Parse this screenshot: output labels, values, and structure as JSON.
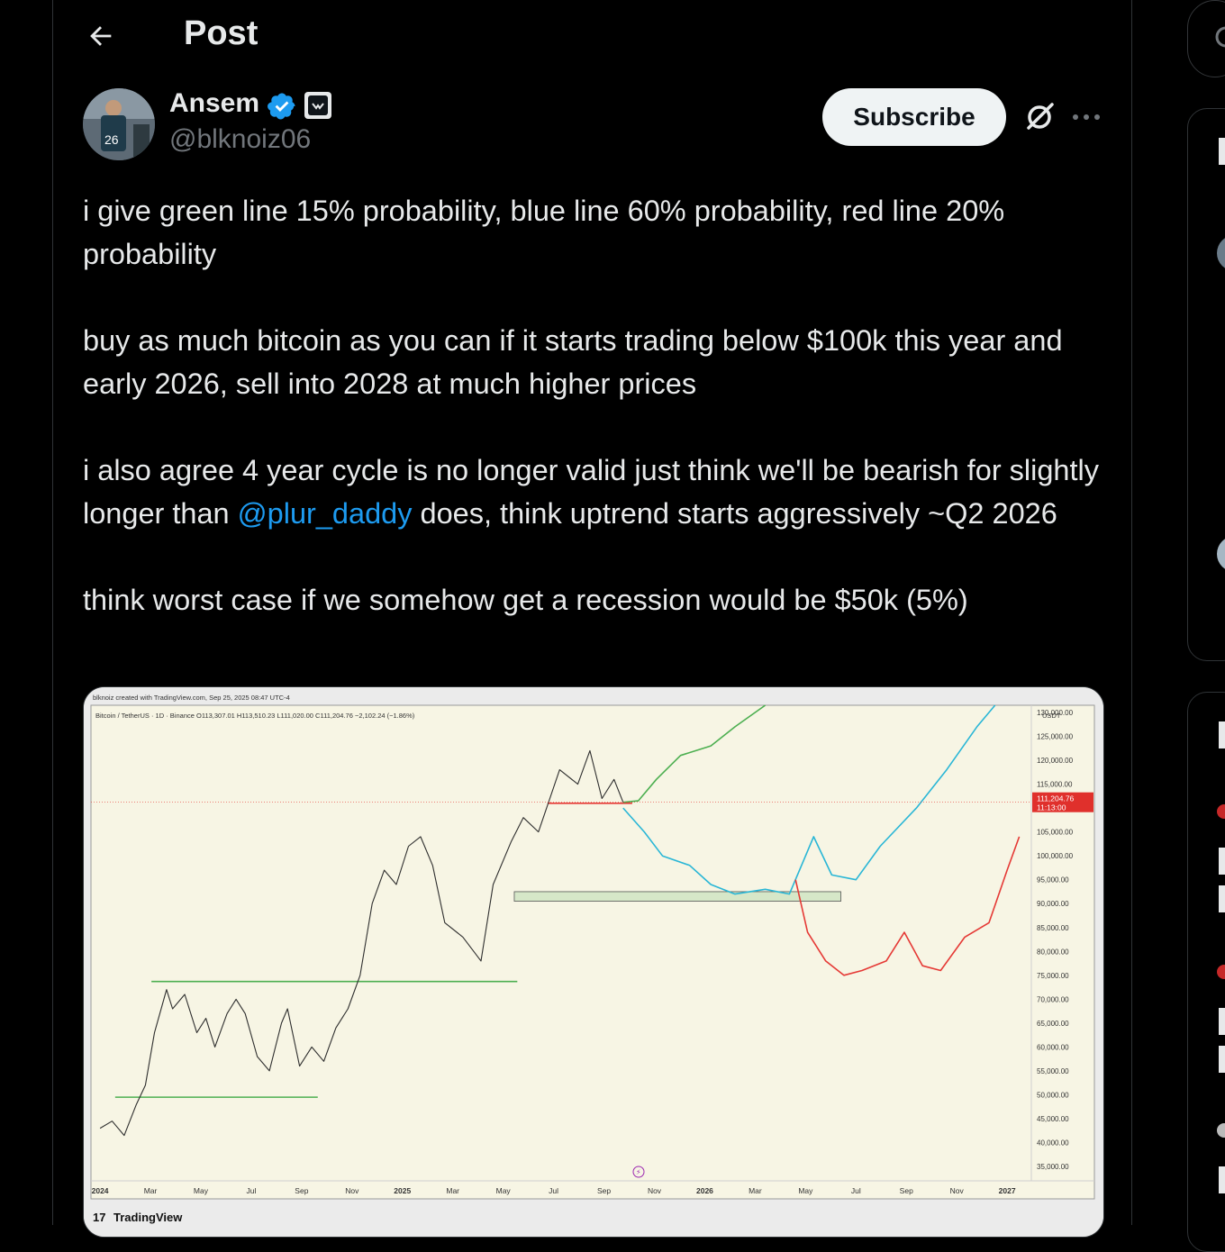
{
  "header": {
    "title": "Post"
  },
  "author": {
    "name": "Ansem",
    "handle": "@blknoiz06"
  },
  "actions": {
    "subscribe": "Subscribe"
  },
  "post": {
    "line1": "i give green line 15% probability, blue line 60% probability, red line 20% probability",
    "line2": "buy as much bitcoin as you can if it starts trading below $100k this year and early 2026, sell into 2028 at much higher prices",
    "line3_before": "i also agree 4 year cycle is no longer valid just think we'll be bearish for slightly longer than ",
    "line3_mention": "@plur_daddy",
    "line3_after": " does, think uptrend starts aggressively ~Q2 2026",
    "line4": "think worst case if we somehow get a recession would be $50k (5%)"
  },
  "media": {
    "watermark": "blknoiz created with TradingView.com, Sep 25, 2025 08:47 UTC-4",
    "symbol_line": "Bitcoin / TetherUS · 1D · Binance  O113,307.01  H113,510.23  L111,020.00  C111,204.76  −2,102.24 (−1.86%)",
    "currency": "USDT",
    "price_tag": "111,204.76",
    "price_time": "11:13:00",
    "brand": "TradingView",
    "chart_data": {
      "type": "line",
      "title": "Bitcoin / TetherUS · 1D · Binance",
      "y_ticks": [
        "130,000.00",
        "125,000.00",
        "120,000.00",
        "115,000.00",
        "105,000.00",
        "100,000.00",
        "95,000.00",
        "90,000.00",
        "85,000.00",
        "80,000.00",
        "75,000.00",
        "70,000.00",
        "65,000.00",
        "60,000.00",
        "55,000.00",
        "50,000.00",
        "45,000.00",
        "40,000.00",
        "35,000.00"
      ],
      "x_ticks": [
        "2024",
        "Mar",
        "May",
        "Jul",
        "Sep",
        "Nov",
        "2025",
        "Mar",
        "May",
        "Jul",
        "Sep",
        "Nov",
        "2026",
        "Mar",
        "May",
        "Jul",
        "Sep",
        "Nov",
        "2027"
      ],
      "ylim": [
        32000,
        131500
      ],
      "last_price": 111204.76,
      "series": [
        {
          "color": "#2e2e2e",
          "points": [
            [
              2024.0,
              43000
            ],
            [
              2024.04,
              44500
            ],
            [
              2024.08,
              41500
            ],
            [
              2024.12,
              48000
            ],
            [
              2024.15,
              52000
            ],
            [
              2024.18,
              63000
            ],
            [
              2024.22,
              72000
            ],
            [
              2024.24,
              68000
            ],
            [
              2024.28,
              71000
            ],
            [
              2024.32,
              63000
            ],
            [
              2024.35,
              66000
            ],
            [
              2024.38,
              60000
            ],
            [
              2024.42,
              67000
            ],
            [
              2024.45,
              70000
            ],
            [
              2024.48,
              67000
            ],
            [
              2024.52,
              58000
            ],
            [
              2024.56,
              55000
            ],
            [
              2024.6,
              65000
            ],
            [
              2024.62,
              68000
            ],
            [
              2024.66,
              56000
            ],
            [
              2024.7,
              60000
            ],
            [
              2024.74,
              57000
            ],
            [
              2024.78,
              64000
            ],
            [
              2024.82,
              68000
            ],
            [
              2024.86,
              75000
            ],
            [
              2024.9,
              90000
            ],
            [
              2024.94,
              97000
            ],
            [
              2024.98,
              94000
            ],
            [
              2025.02,
              102000
            ],
            [
              2025.06,
              104000
            ],
            [
              2025.1,
              98000
            ],
            [
              2025.14,
              86000
            ],
            [
              2025.2,
              83000
            ],
            [
              2025.26,
              78000
            ],
            [
              2025.3,
              94000
            ],
            [
              2025.36,
              103000
            ],
            [
              2025.4,
              108000
            ],
            [
              2025.45,
              105000
            ],
            [
              2025.52,
              118000
            ],
            [
              2025.58,
              115000
            ],
            [
              2025.62,
              122000
            ],
            [
              2025.66,
              112000
            ],
            [
              2025.7,
              116000
            ],
            [
              2025.73,
              111200
            ]
          ]
        },
        {
          "color": "#4caf50",
          "points": [
            [
              2025.73,
              111200
            ],
            [
              2025.78,
              111500
            ],
            [
              2025.84,
              116000
            ],
            [
              2025.92,
              121000
            ],
            [
              2026.02,
              123000
            ],
            [
              2026.1,
              127000
            ],
            [
              2026.2,
              131500
            ]
          ]
        },
        {
          "color": "#29b6d6",
          "points": [
            [
              2025.73,
              110000
            ],
            [
              2025.8,
              105000
            ],
            [
              2025.86,
              100000
            ],
            [
              2025.95,
              98000
            ],
            [
              2026.02,
              94000
            ],
            [
              2026.1,
              92000
            ],
            [
              2026.2,
              93000
            ],
            [
              2026.28,
              92000
            ],
            [
              2026.36,
              104000
            ],
            [
              2026.42,
              96000
            ],
            [
              2026.5,
              95000
            ],
            [
              2026.58,
              102000
            ],
            [
              2026.7,
              110000
            ],
            [
              2026.8,
              118000
            ],
            [
              2026.9,
              127000
            ],
            [
              2026.96,
              131500
            ]
          ]
        },
        {
          "color": "#e53935",
          "points": [
            [
              2026.3,
              95000
            ],
            [
              2026.34,
              84000
            ],
            [
              2026.4,
              78000
            ],
            [
              2026.46,
              75000
            ],
            [
              2026.52,
              76000
            ],
            [
              2026.6,
              78000
            ],
            [
              2026.66,
              84000
            ],
            [
              2026.72,
              77000
            ],
            [
              2026.78,
              76000
            ],
            [
              2026.86,
              83000
            ],
            [
              2026.94,
              86000
            ],
            [
              2027.0,
              97000
            ],
            [
              2027.04,
              104000
            ]
          ]
        }
      ],
      "levels": [
        {
          "color": "#4caf50",
          "value": 49500,
          "x_from": 2024.05,
          "x_to": 2024.72
        },
        {
          "color": "#4caf50",
          "value": 73700,
          "x_from": 2024.17,
          "x_to": 2025.38
        },
        {
          "color": "#e53935",
          "value": 111000,
          "x_from": 2025.48,
          "x_to": 2025.76
        }
      ],
      "zone": {
        "from": 90500,
        "to": 92500,
        "x_from": 2025.37,
        "x_to": 2026.45
      }
    }
  }
}
